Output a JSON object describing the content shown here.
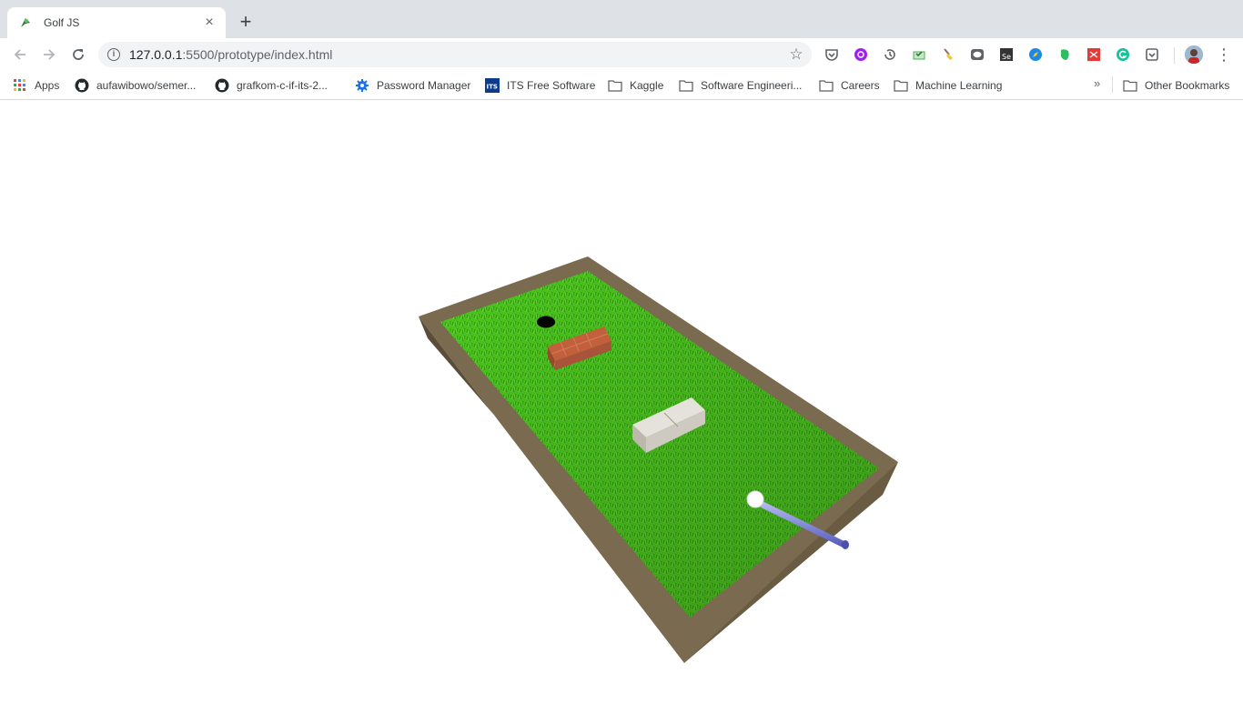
{
  "tab": {
    "title": "Golf JS",
    "favicon": "golf-js-icon"
  },
  "toolbar": {
    "url_host": "127.0.0.1",
    "url_path": ":5500/prototype/index.html",
    "extensions": [
      "pocket-icon",
      "purple-globe-icon",
      "history-icon",
      "mail-check-icon",
      "broom-icon",
      "line-icon",
      "selenium-icon",
      "compass-icon",
      "evernote-icon",
      "pdf-icon",
      "grammarly-icon",
      "pocket-save-icon"
    ]
  },
  "bookmarks": {
    "items": [
      {
        "label": "Apps",
        "icon": "apps-grid-icon"
      },
      {
        "label": "aufawibowo/semer...",
        "icon": "github-icon"
      },
      {
        "label": "grafkom-c-if-its-2...",
        "icon": "github-icon"
      },
      {
        "label": "Password Manager",
        "icon": "gear-icon"
      },
      {
        "label": "ITS Free Software",
        "icon": "its-icon"
      },
      {
        "label": "Kaggle",
        "icon": "folder-icon"
      },
      {
        "label": "Software Engineeri...",
        "icon": "folder-icon"
      },
      {
        "label": "Careers",
        "icon": "folder-icon"
      },
      {
        "label": "Machine Learning",
        "icon": "folder-icon"
      }
    ],
    "overflow": "»",
    "other": "Other Bookmarks"
  },
  "scene": {
    "grass_color": "#4fd21e",
    "wall_color": "#6f6148",
    "brick_color": "#c2603c",
    "stone_color": "#e5e2dc",
    "ball_color": "#ffffff",
    "club_color": "#7b80d8"
  }
}
